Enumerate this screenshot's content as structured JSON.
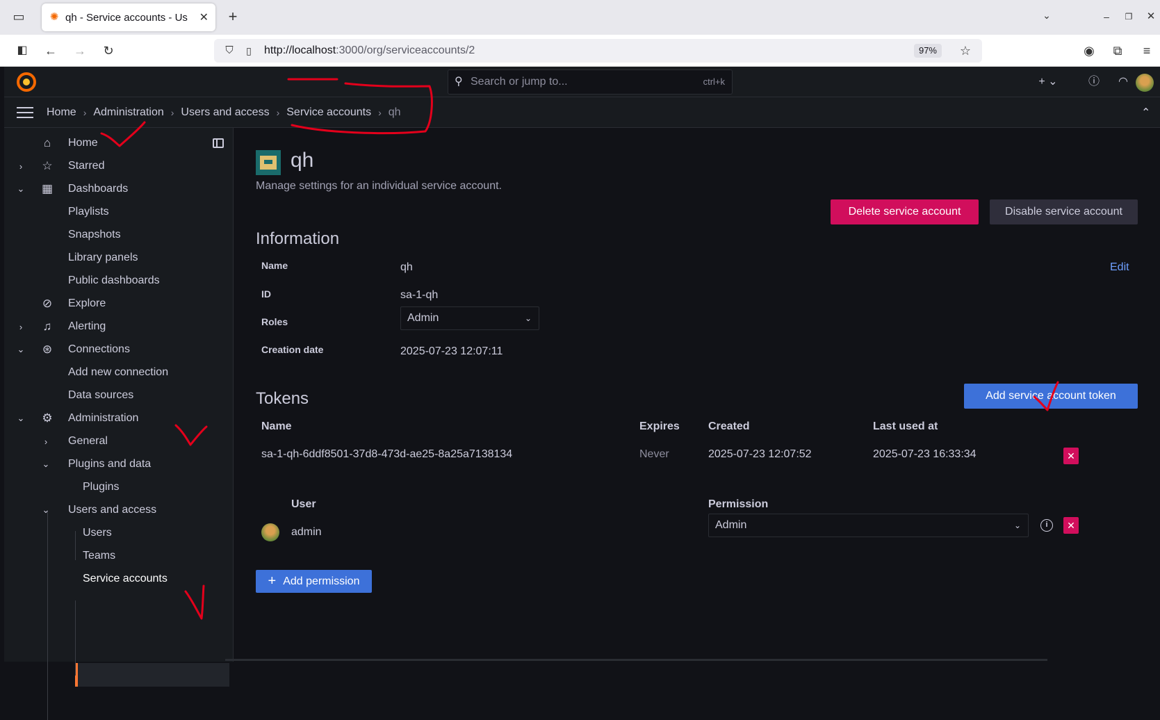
{
  "browser": {
    "tab_title": "qh - Service accounts - Us",
    "url_host": "http://localhost",
    "url_path": ":3000/org/serviceaccounts/2",
    "zoom": "97%"
  },
  "topbar": {
    "search_placeholder": "Search or jump to...",
    "search_shortcut": "ctrl+k"
  },
  "breadcrumbs": [
    "Home",
    "Administration",
    "Users and access",
    "Service accounts",
    "qh"
  ],
  "sidebar": {
    "items": [
      {
        "label": "Home"
      },
      {
        "label": "Starred"
      },
      {
        "label": "Dashboards"
      },
      {
        "label": "Playlists"
      },
      {
        "label": "Snapshots"
      },
      {
        "label": "Library panels"
      },
      {
        "label": "Public dashboards"
      },
      {
        "label": "Explore"
      },
      {
        "label": "Alerting"
      },
      {
        "label": "Connections"
      },
      {
        "label": "Add new connection"
      },
      {
        "label": "Data sources"
      },
      {
        "label": "Administration"
      },
      {
        "label": "General"
      },
      {
        "label": "Plugins and data"
      },
      {
        "label": "Plugins"
      },
      {
        "label": "Users and access"
      },
      {
        "label": "Users"
      },
      {
        "label": "Teams"
      },
      {
        "label": "Service accounts"
      }
    ]
  },
  "page": {
    "title": "qh",
    "subtitle": "Manage settings for an individual service account.",
    "delete_button": "Delete service account",
    "disable_button": "Disable service account"
  },
  "information": {
    "heading": "Information",
    "edit_label": "Edit",
    "name_label": "Name",
    "name_value": "qh",
    "id_label": "ID",
    "id_value": "sa-1-qh",
    "roles_label": "Roles",
    "roles_value": "Admin",
    "creation_label": "Creation date",
    "creation_value": "2025-07-23 12:07:11"
  },
  "tokens": {
    "heading": "Tokens",
    "add_button": "Add service account token",
    "columns": [
      "Name",
      "Expires",
      "Created",
      "Last used at"
    ],
    "rows": [
      {
        "name": "sa-1-qh-6ddf8501-37d8-473d-ae25-8a25a7138134",
        "expires": "Never",
        "created": "2025-07-23 12:07:52",
        "last_used": "2025-07-23 16:33:34"
      }
    ]
  },
  "permissions": {
    "user_header": "User",
    "permission_header": "Permission",
    "rows": [
      {
        "user": "admin",
        "permission": "Admin"
      }
    ],
    "add_button": "Add permission"
  },
  "colors": {
    "accent_primary": "#3d71d9",
    "danger": "#d10e5c",
    "active_nav": "#ff7733",
    "annotation_red": "#e3001b"
  }
}
